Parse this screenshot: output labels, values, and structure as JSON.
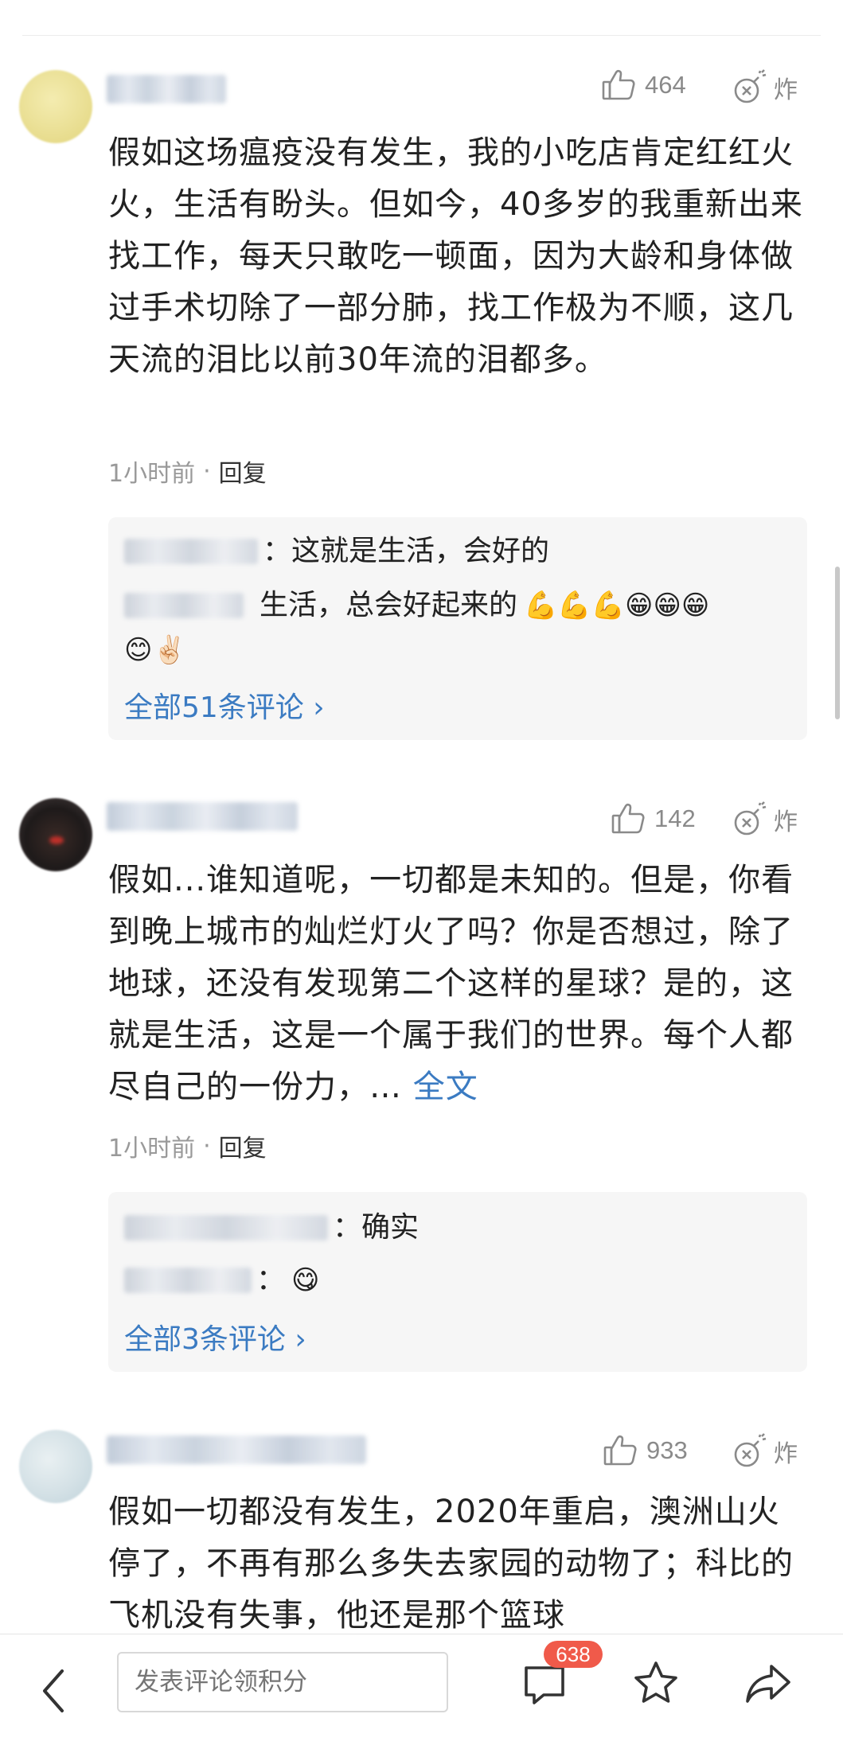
{
  "comments": [
    {
      "likes": "464",
      "bomb_label": "炸",
      "text": "假如这场瘟疫没有发生，我的小吃店肯定红红火火，生活有盼头。但如今，40多岁的我重新出来找工作，每天只敢吃一顿面，因为大龄和身体做过手术切除了一部分肺，找工作极为不顺，这几天流的泪比以前30年流的泪都多。",
      "time": "1小时前",
      "reply_label": "回复",
      "replies": [
        {
          "text": "：这就是生活，会好的"
        },
        {
          "text": "生活，总会好起来的",
          "emoji_line1": "💪💪💪😁😁😁",
          "emoji_line2": "😊✌🏻"
        }
      ],
      "all_comments": "全部51条评论 ›"
    },
    {
      "likes": "142",
      "bomb_label": "炸",
      "text": "假如...谁知道呢，一切都是未知的。但是，你看到晚上城市的灿烂灯火了吗？你是否想过，除了地球，还没有发现第二个这样的星球？是的，这就是生活，这是一个属于我们的世界。每个人都尽自己的一份力，…",
      "more_label": "全文",
      "time": "1小时前",
      "reply_label": "回复",
      "replies": [
        {
          "text": "：确实"
        },
        {
          "text": "：",
          "emoji": "😋"
        }
      ],
      "all_comments": "全部3条评论 ›"
    },
    {
      "likes": "933",
      "bomb_label": "炸",
      "text": "假如一切都没有发生，2020年重启，澳洲山火停了，不再有那么多失去家园的动物了；科比的飞机没有失事，他还是那个篮球"
    }
  ],
  "bottom_bar": {
    "input_placeholder": "发表评论领积分",
    "comment_count_badge": "638",
    "icons": [
      "back-arrow-icon",
      "comment-bubble-icon",
      "star-icon",
      "share-icon"
    ]
  },
  "colors": {
    "link": "#3b7bc2",
    "badge": "#f05a4a",
    "muted": "#999999",
    "reply_bg": "#f6f6f6"
  }
}
